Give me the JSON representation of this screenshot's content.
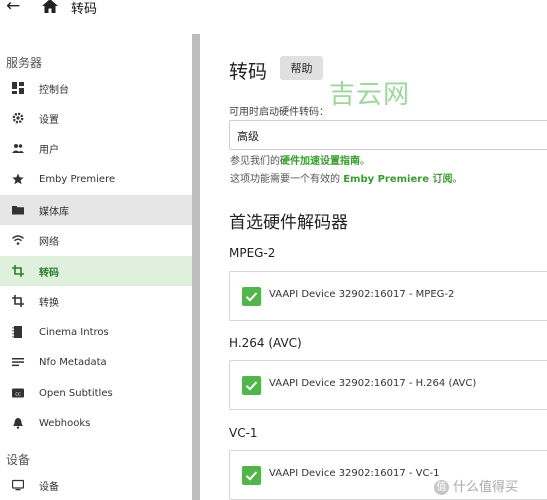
{
  "header": {
    "title": "转码"
  },
  "sidebar": {
    "sections": [
      {
        "title": "服务器"
      },
      {
        "title": "设备"
      }
    ],
    "items": [
      {
        "label": "控制台",
        "icon": "dashboard-icon"
      },
      {
        "label": "设置",
        "icon": "gear-icon"
      },
      {
        "label": "用户",
        "icon": "people-icon"
      },
      {
        "label": "Emby Premiere",
        "icon": "star-icon"
      },
      {
        "label": "媒体库",
        "icon": "folder-icon"
      },
      {
        "label": "网络",
        "icon": "wifi-icon"
      },
      {
        "label": "转码",
        "icon": "transcode-icon"
      },
      {
        "label": "转换",
        "icon": "convert-icon"
      },
      {
        "label": "Cinema Intros",
        "icon": "film-icon"
      },
      {
        "label": "Nfo Metadata",
        "icon": "notes-icon"
      },
      {
        "label": "Open Subtitles",
        "icon": "cc-icon"
      },
      {
        "label": "Webhooks",
        "icon": "bell-icon"
      },
      {
        "label": "设备",
        "icon": "device-icon"
      }
    ]
  },
  "main": {
    "title": "转码",
    "help_label": "帮助",
    "watermark": "吉云网",
    "hw_label": "可用时启动硬件转码：",
    "hw_value": "高级",
    "helper1_prefix": "参见我们的",
    "helper1_link": "硬件加速设置指南",
    "helper1_suffix": "。",
    "helper2_prefix": "这项功能需要一个有效的 ",
    "helper2_link": "Emby Premiere 订阅",
    "helper2_suffix": "。",
    "section_title": "首选硬件解码器",
    "codecs": [
      {
        "title": "MPEG-2",
        "option": "VAAPI Device 32902:16017 - MPEG-2",
        "checked": true
      },
      {
        "title": "H.264 (AVC)",
        "option": "VAAPI Device 32902:16017 - H.264 (AVC)",
        "checked": true
      },
      {
        "title": "VC-1",
        "option": "VAAPI Device 32902:16017 - VC-1",
        "checked": true
      }
    ]
  },
  "corner_mark": {
    "badge": "值",
    "text": "什么值得买"
  },
  "colors": {
    "accent": "#52b54b",
    "active_bg": "#dff0dc",
    "hover_bg": "#e6e6e6",
    "link": "#3a9b2f"
  }
}
